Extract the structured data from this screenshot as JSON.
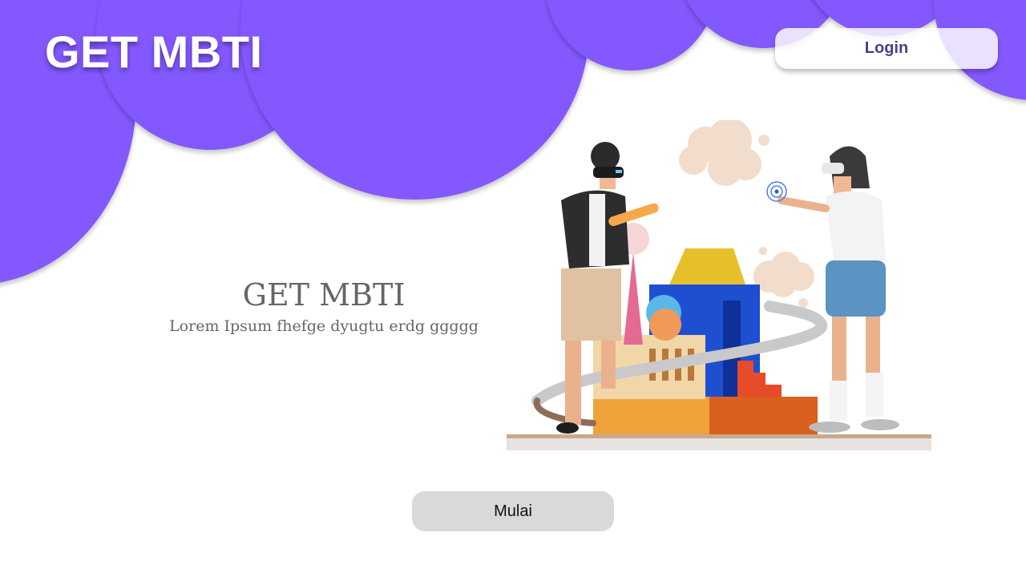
{
  "header": {
    "brand": "GET MBTI",
    "login_label": "Login"
  },
  "hero": {
    "title": "GET MBTI",
    "subtitle": "Lorem Ipsum fhefge dyugtu erdg ggggg",
    "cta_label": "Mulai"
  },
  "colors": {
    "accent": "#8458ff",
    "button_gray": "#d9d9d9",
    "text_gray": "#666666",
    "login_text": "#4b3f86"
  },
  "illustration": {
    "subject": "two people with vr headsets building toy blocks"
  }
}
